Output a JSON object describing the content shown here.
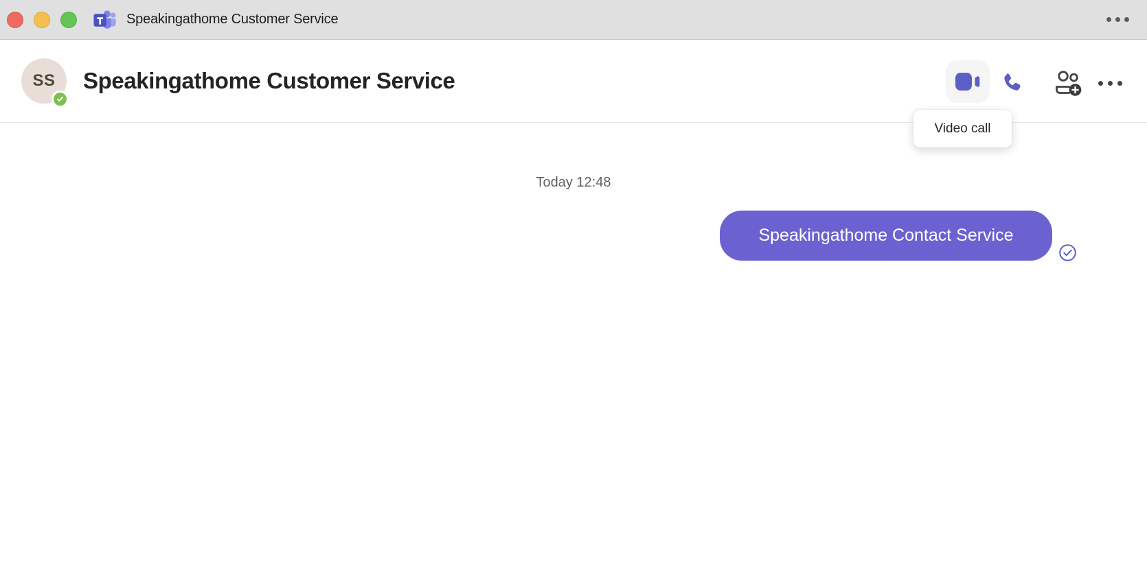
{
  "colors": {
    "accent_purple": "#5b5fc7",
    "bubble_purple": "#6c61d0",
    "presence_green": "#7cc14f",
    "titlebar_bg": "#e0e0e0",
    "icon_dark": "#424242",
    "avatar_bg": "#e9ded7"
  },
  "window": {
    "title": "Speakingathome Customer Service",
    "traffic_lights": [
      "close",
      "minimize",
      "fullscreen"
    ],
    "more_icon": "ellipsis-icon",
    "app_icon": "teams-logo-icon"
  },
  "header": {
    "title": "Speakingathome Customer Service",
    "avatar_initials": "SS",
    "presence_status": "available",
    "action_icons": [
      "video-camera-icon",
      "phone-icon",
      "add-people-icon",
      "more-options-icon"
    ],
    "tooltip": "Video call"
  },
  "chat": {
    "date_divider": "Today 12:48",
    "messages": [
      {
        "text": "Speakingathome Contact Service",
        "direction": "outgoing",
        "status_icon": "seen-check-icon"
      }
    ]
  }
}
